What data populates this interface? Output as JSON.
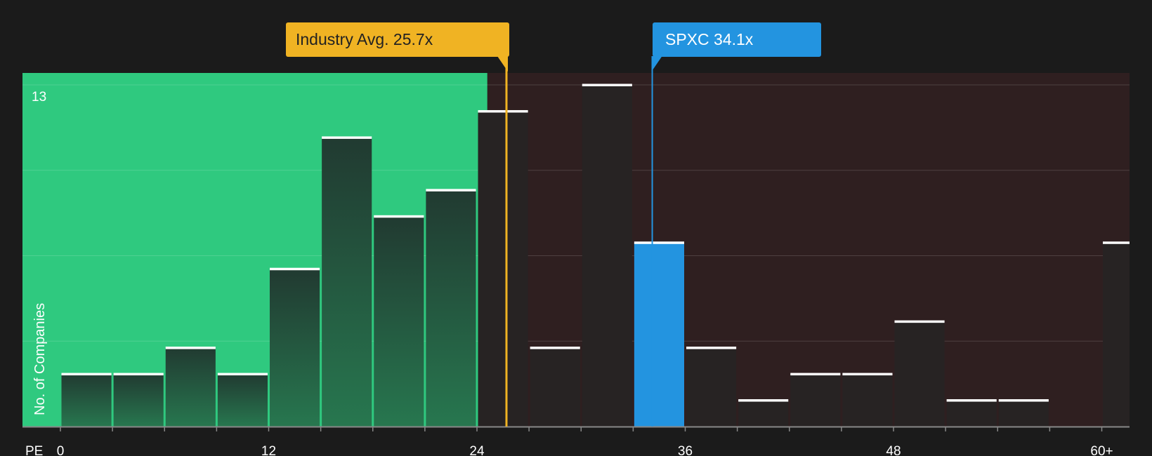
{
  "chart_data": {
    "type": "bar",
    "x_axis_label": "PE",
    "y_axis_label": "No. of Companies",
    "y_max_label": "13",
    "ylim": [
      0,
      13
    ],
    "x_ticks": [
      "0",
      "12",
      "24",
      "36",
      "48",
      "60+"
    ],
    "bin_edges": [
      0,
      3,
      6,
      9,
      12,
      15,
      18,
      21,
      24,
      27,
      30,
      33,
      36,
      39,
      42,
      45,
      48,
      51,
      54,
      57,
      60
    ],
    "values": [
      2,
      2,
      3,
      2,
      6,
      11,
      8,
      9,
      12,
      3,
      13,
      7,
      3,
      1,
      2,
      2,
      4,
      1,
      1,
      0,
      7
    ],
    "highlighted_bin": 11,
    "grid": true,
    "shaded_regions": [
      {
        "from": 0,
        "to": 24.6,
        "color": "#2fc97f"
      },
      {
        "from": 24.6,
        "to": 63,
        "color": "#2f1f20"
      }
    ],
    "reference_lines": [
      {
        "label": "Industry Avg. 25.7x",
        "value": 25.7,
        "color": "#f0b323"
      },
      {
        "label": "SPXC 34.1x",
        "value": 34.1,
        "color": "#2394e0"
      }
    ]
  }
}
